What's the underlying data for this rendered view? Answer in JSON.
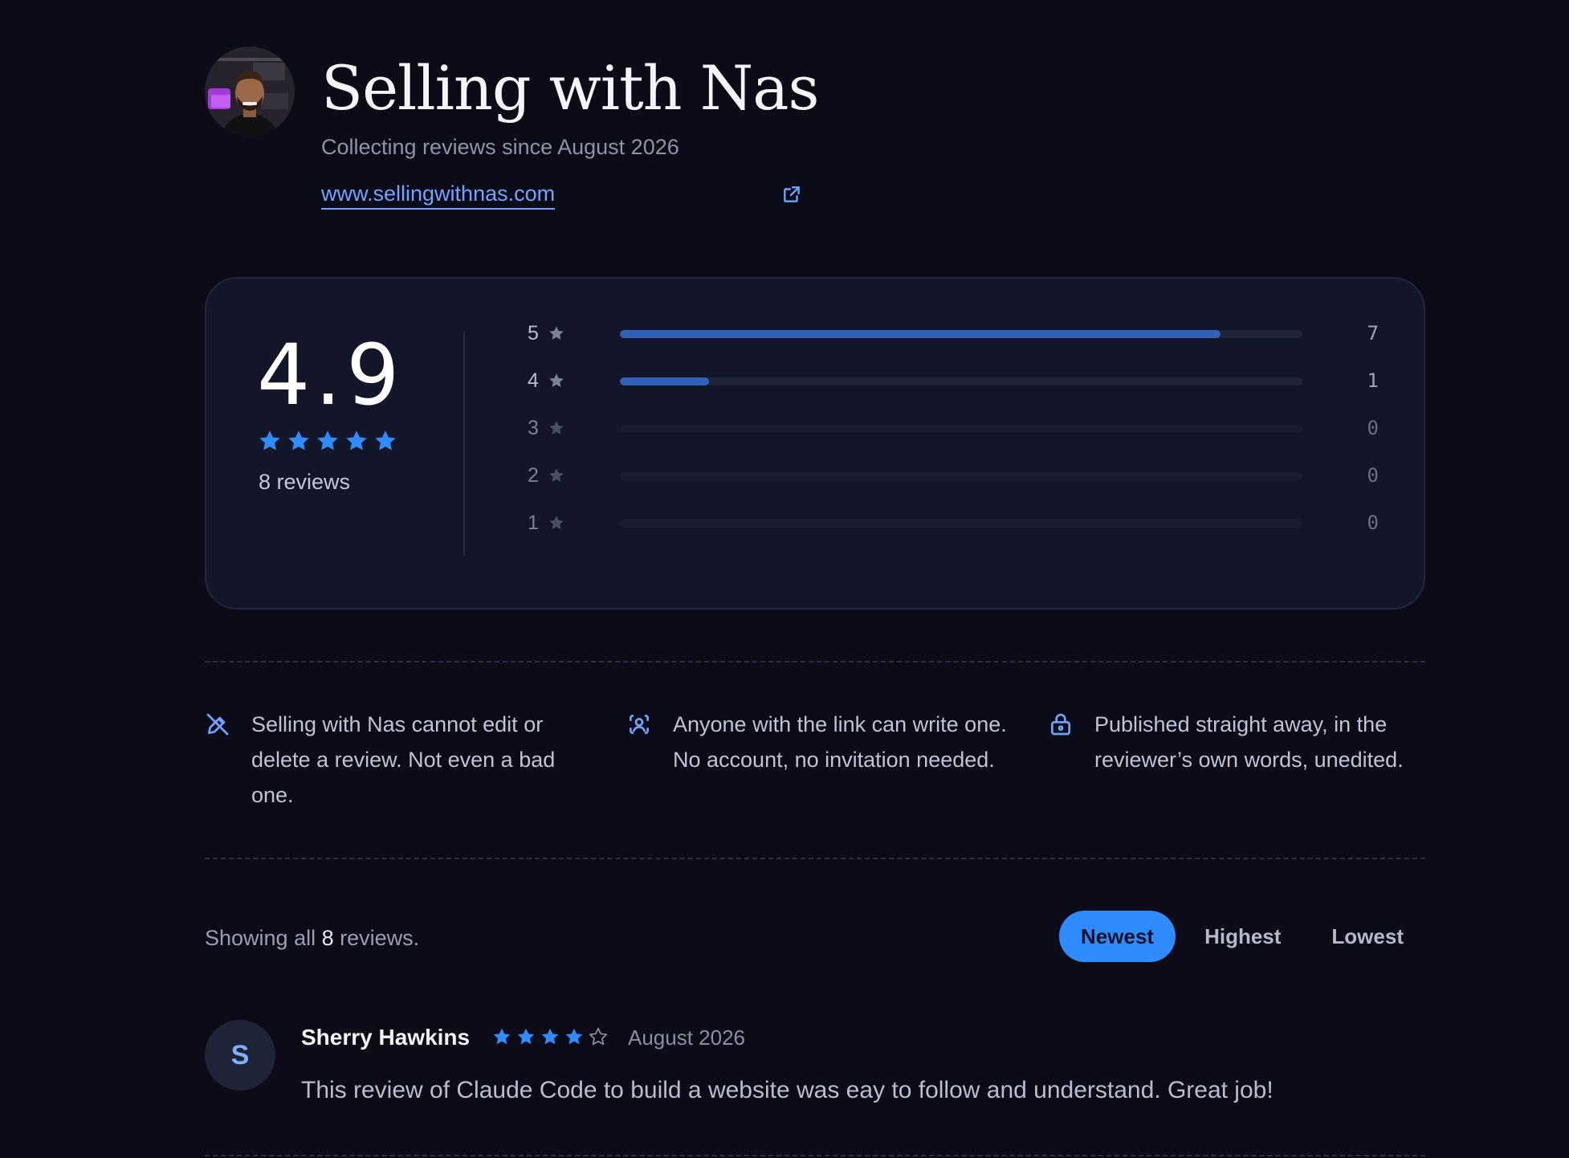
{
  "profile": {
    "title": "Selling with Nas",
    "subtitle": "Collecting reviews since August 2026",
    "website": "www.sellingwithnas.com"
  },
  "rating": {
    "score": "4.9",
    "stars": 5,
    "count_label": "8 reviews",
    "distribution": [
      {
        "stars": "5",
        "count": "7",
        "fraction": 0.88
      },
      {
        "stars": "4",
        "count": "1",
        "fraction": 0.13
      },
      {
        "stars": "3",
        "count": "0",
        "fraction": 0
      },
      {
        "stars": "2",
        "count": "0",
        "fraction": 0
      },
      {
        "stars": "1",
        "count": "0",
        "fraction": 0
      }
    ]
  },
  "features": [
    {
      "icon": "pencil-off-icon",
      "text": "Selling with Nas cannot edit or delete a review. Not even a bad one."
    },
    {
      "icon": "user-scan-icon",
      "text": "Anyone with the link can write one. No account, no invitation needed."
    },
    {
      "icon": "lock-icon",
      "text": "Published straight away, in the reviewer’s own words, unedited."
    }
  ],
  "listing": {
    "showing_prefix": "Showing all",
    "showing_count": "8",
    "showing_suffix": "reviews.",
    "sort_options": [
      "Newest",
      "Highest",
      "Lowest"
    ],
    "active_sort": "Newest"
  },
  "reviews": [
    {
      "initial": "S",
      "name": "Sherry Hawkins",
      "rating": 4,
      "date": "August 2026",
      "body": "This review of Claude Code to build a website was eay to follow and understand. Great job!"
    }
  ],
  "colors": {
    "background": "#0b0c17",
    "card": "#131628",
    "accent": "#2f8cff",
    "star": "#2f8cff",
    "bar_fill": "#3062b8",
    "link": "#6fa4ff"
  }
}
